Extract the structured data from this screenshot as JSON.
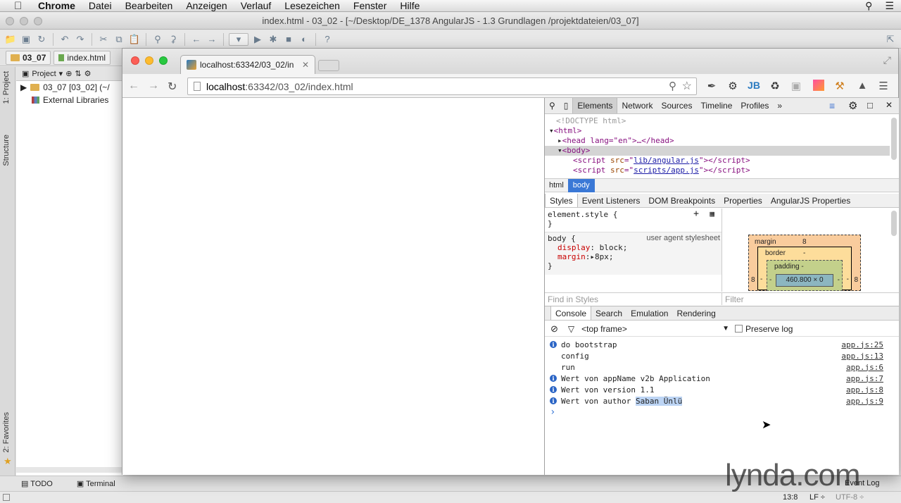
{
  "menubar": {
    "app": "Chrome",
    "items": [
      "Datei",
      "Bearbeiten",
      "Anzeigen",
      "Verlauf",
      "Lesezeichen",
      "Fenster",
      "Hilfe"
    ]
  },
  "ide": {
    "title": "index.html - 03_02 - [~/Desktop/DE_1378 AngularJS - 1.3 Grundlagen /projektdateien/03_07]",
    "breadcrumb": [
      "03_07",
      "index.html"
    ],
    "side_tabs": [
      "1: Project",
      "Structure",
      "2: Favorites"
    ],
    "project_header": "Project",
    "tree": [
      "03_07 [03_02] (~/",
      "External Libraries"
    ],
    "bottom_tabs": [
      "TODO",
      "Terminal"
    ],
    "status": {
      "position": "13:8",
      "line_sep": "LF ÷",
      "encoding": "UTF-8 ÷",
      "event_log": "Event Log"
    }
  },
  "chrome": {
    "tab_title": "localhost:63342/03_02/in",
    "url_host": "localhost",
    "url_rest": ":63342/03_02/index.html"
  },
  "devtools": {
    "tabs": [
      "Elements",
      "Network",
      "Sources",
      "Timeline",
      "Profiles"
    ],
    "dom": {
      "doctype": "<!DOCTYPE html>",
      "html_open": "<html>",
      "head": "<head lang=\"en\">…</head>",
      "body": "<body>",
      "script1_src": "lib/angular.js",
      "script2_src": "scripts/app.js"
    },
    "path": [
      "html",
      "body"
    ],
    "style_tabs": [
      "Styles",
      "Event Listeners",
      "DOM Breakpoints",
      "Properties",
      "AngularJS Properties"
    ],
    "styles": {
      "element_style": "element.style {",
      "close": "}",
      "body_rule": "body {",
      "ua_label": "user agent stylesheet",
      "decl1_prop": "display",
      "decl1_val": "block;",
      "decl2_prop": "margin",
      "decl2_val": "8px;",
      "find_placeholder": "Find in Styles",
      "filter_placeholder": "Filter"
    },
    "boxmodel": {
      "margin_label": "margin",
      "margin_val": "8",
      "border_label": "border",
      "border_val": "-",
      "padding_label": "padding -",
      "content": "460.800 × 0",
      "side_left": "8",
      "side_right": "8",
      "dash": "-"
    },
    "console_tabs": [
      "Console",
      "Search",
      "Emulation",
      "Rendering"
    ],
    "frame": "<top frame>",
    "preserve_log": "Preserve log",
    "console": [
      {
        "info": true,
        "text": "do bootstrap",
        "src": "app.js:25"
      },
      {
        "info": false,
        "text": "config",
        "src": "app.js:13"
      },
      {
        "info": false,
        "text": "run",
        "src": "app.js:6"
      },
      {
        "info": true,
        "text": "Wert von appName v2b Application",
        "src": "app.js:7"
      },
      {
        "info": true,
        "text": "Wert von version 1.1",
        "src": "app.js:8"
      },
      {
        "info": true,
        "text": "Wert von author ",
        "highlight": "Saban Ünlü",
        "src": "app.js:9"
      }
    ],
    "prompt": "›"
  },
  "watermark": "lynda.com"
}
